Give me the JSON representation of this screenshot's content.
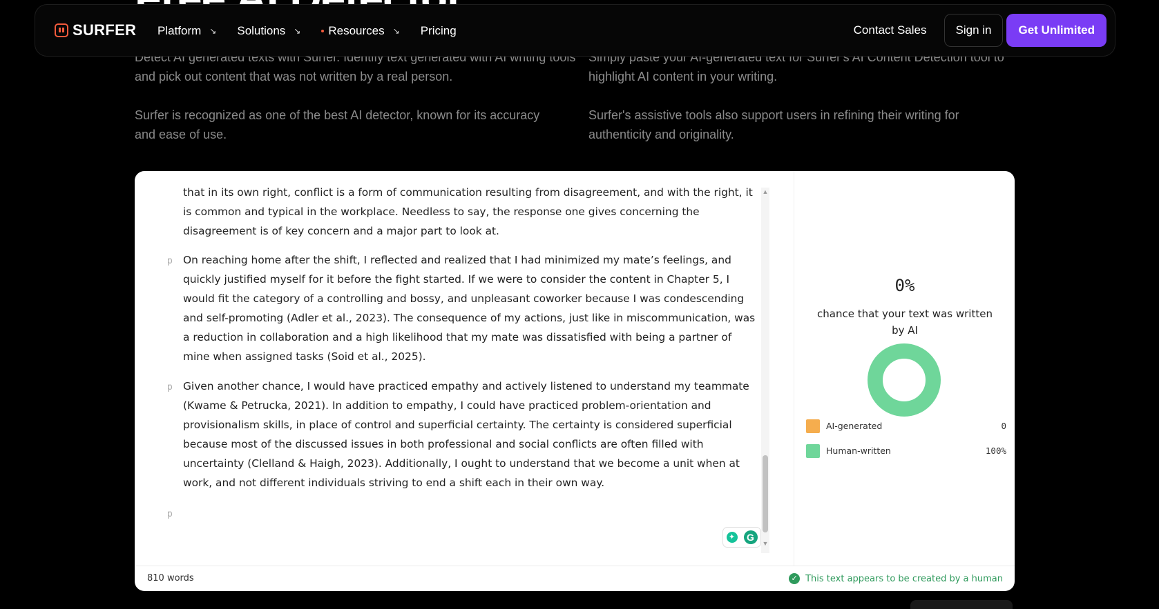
{
  "hero": {
    "title": "Free AI Detector"
  },
  "nav": {
    "logo": "SURFER",
    "items": [
      {
        "label": "Platform",
        "arrow": "↘"
      },
      {
        "label": "Solutions",
        "arrow": "↘"
      },
      {
        "label": "Resources",
        "arrow": "↘"
      },
      {
        "label": "Pricing"
      }
    ],
    "contact": "Contact Sales",
    "signin": "Sign in",
    "get": "Get Unlimited",
    "accent_color": "#7a3cf5"
  },
  "intro": {
    "left1": "Detect AI generated texts with Surfer. Identify text generated with AI writing tools and pick out content that was not written by a real person.",
    "left2": "Surfer is recognized as one of the best AI detector, known for its accuracy and ease of use.",
    "right1": "Simply paste your AI-generated text for Surfer's AI Content Detection tool to highlight AI content in your writing.",
    "right2": "Surfer's assistive tools also support users in refining their writing for authenticity and originality."
  },
  "editor": {
    "paragraphs": [
      "that in its own right, conflict is a form of communication resulting from disagreement, and with the right, it is common and typical in the workplace. Needless to say, the response one gives concerning the disagreement is of key concern and a major part to look at.",
      "On reaching home after the shift, I reflected and realized that I had minimized my mate’s feelings, and quickly justified myself for it before the fight started. If we were to consider the content in Chapter 5, I would fit the category of a controlling and bossy, and unpleasant coworker because I was condescending and self-promoting (Adler et al., 2023). The consequence of my actions, just like in miscommunication, was a reduction in collaboration and a high likelihood that my mate was dissatisfied with being a partner of mine when assigned tasks (Soid et al., 2025).",
      "Given another chance, I would have practiced empathy and actively listened to understand my teammate (Kwame & Petrucka, 2021). In addition to empathy, I could have practiced problem-orientation and provisionalism skills, in place of control and superficial certainty. The certainty is considered superficial because most of the discussed issues in both professional and social conflicts are often filled with uncertainty (Clelland & Haigh, 2023). Additionally, I ought to understand that we become a unit when at work, and not different individuals striving to end a shift each in their own way."
    ],
    "p_marker": "p",
    "word_count": "810 words"
  },
  "result": {
    "percent": "0%",
    "caption": "chance that your text was written by AI",
    "legend": [
      {
        "label": "AI-generated",
        "value": "0",
        "color": "#f5ad4e"
      },
      {
        "label": "Human-written",
        "value": "100%",
        "color": "#6fd69a"
      }
    ],
    "status": "This text appears to be created by a human",
    "donut_human_fraction": 1.0
  }
}
